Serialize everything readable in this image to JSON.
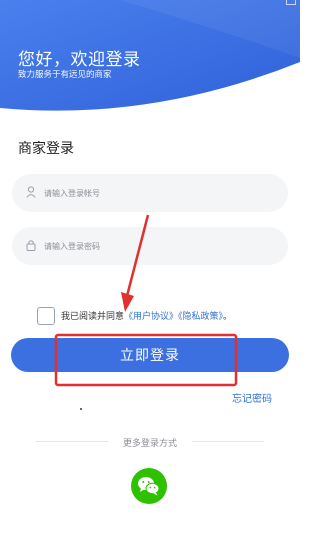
{
  "header": {
    "greeting": "您好，欢迎登录",
    "subtitle": "致力服务于有远见的商家"
  },
  "login": {
    "section_title": "商家登录",
    "account_placeholder": "请输入登录帐号",
    "password_placeholder": "请输入登录密码",
    "agree_prefix": "我已阅读并同意",
    "user_agreement": "《用户协议》",
    "privacy_policy": "《隐私政策》",
    "agree_suffix": "。",
    "submit_label": "立即登录",
    "forgot_label": "忘记密码"
  },
  "more_login": {
    "label": "更多登录方式",
    "options": [
      "wechat-icon"
    ]
  },
  "colors": {
    "primary": "#3c6fe0",
    "hero": "#3a6fe0",
    "link": "#2f6fd6",
    "wechat": "#2dc100",
    "annotation": "#e03030"
  }
}
